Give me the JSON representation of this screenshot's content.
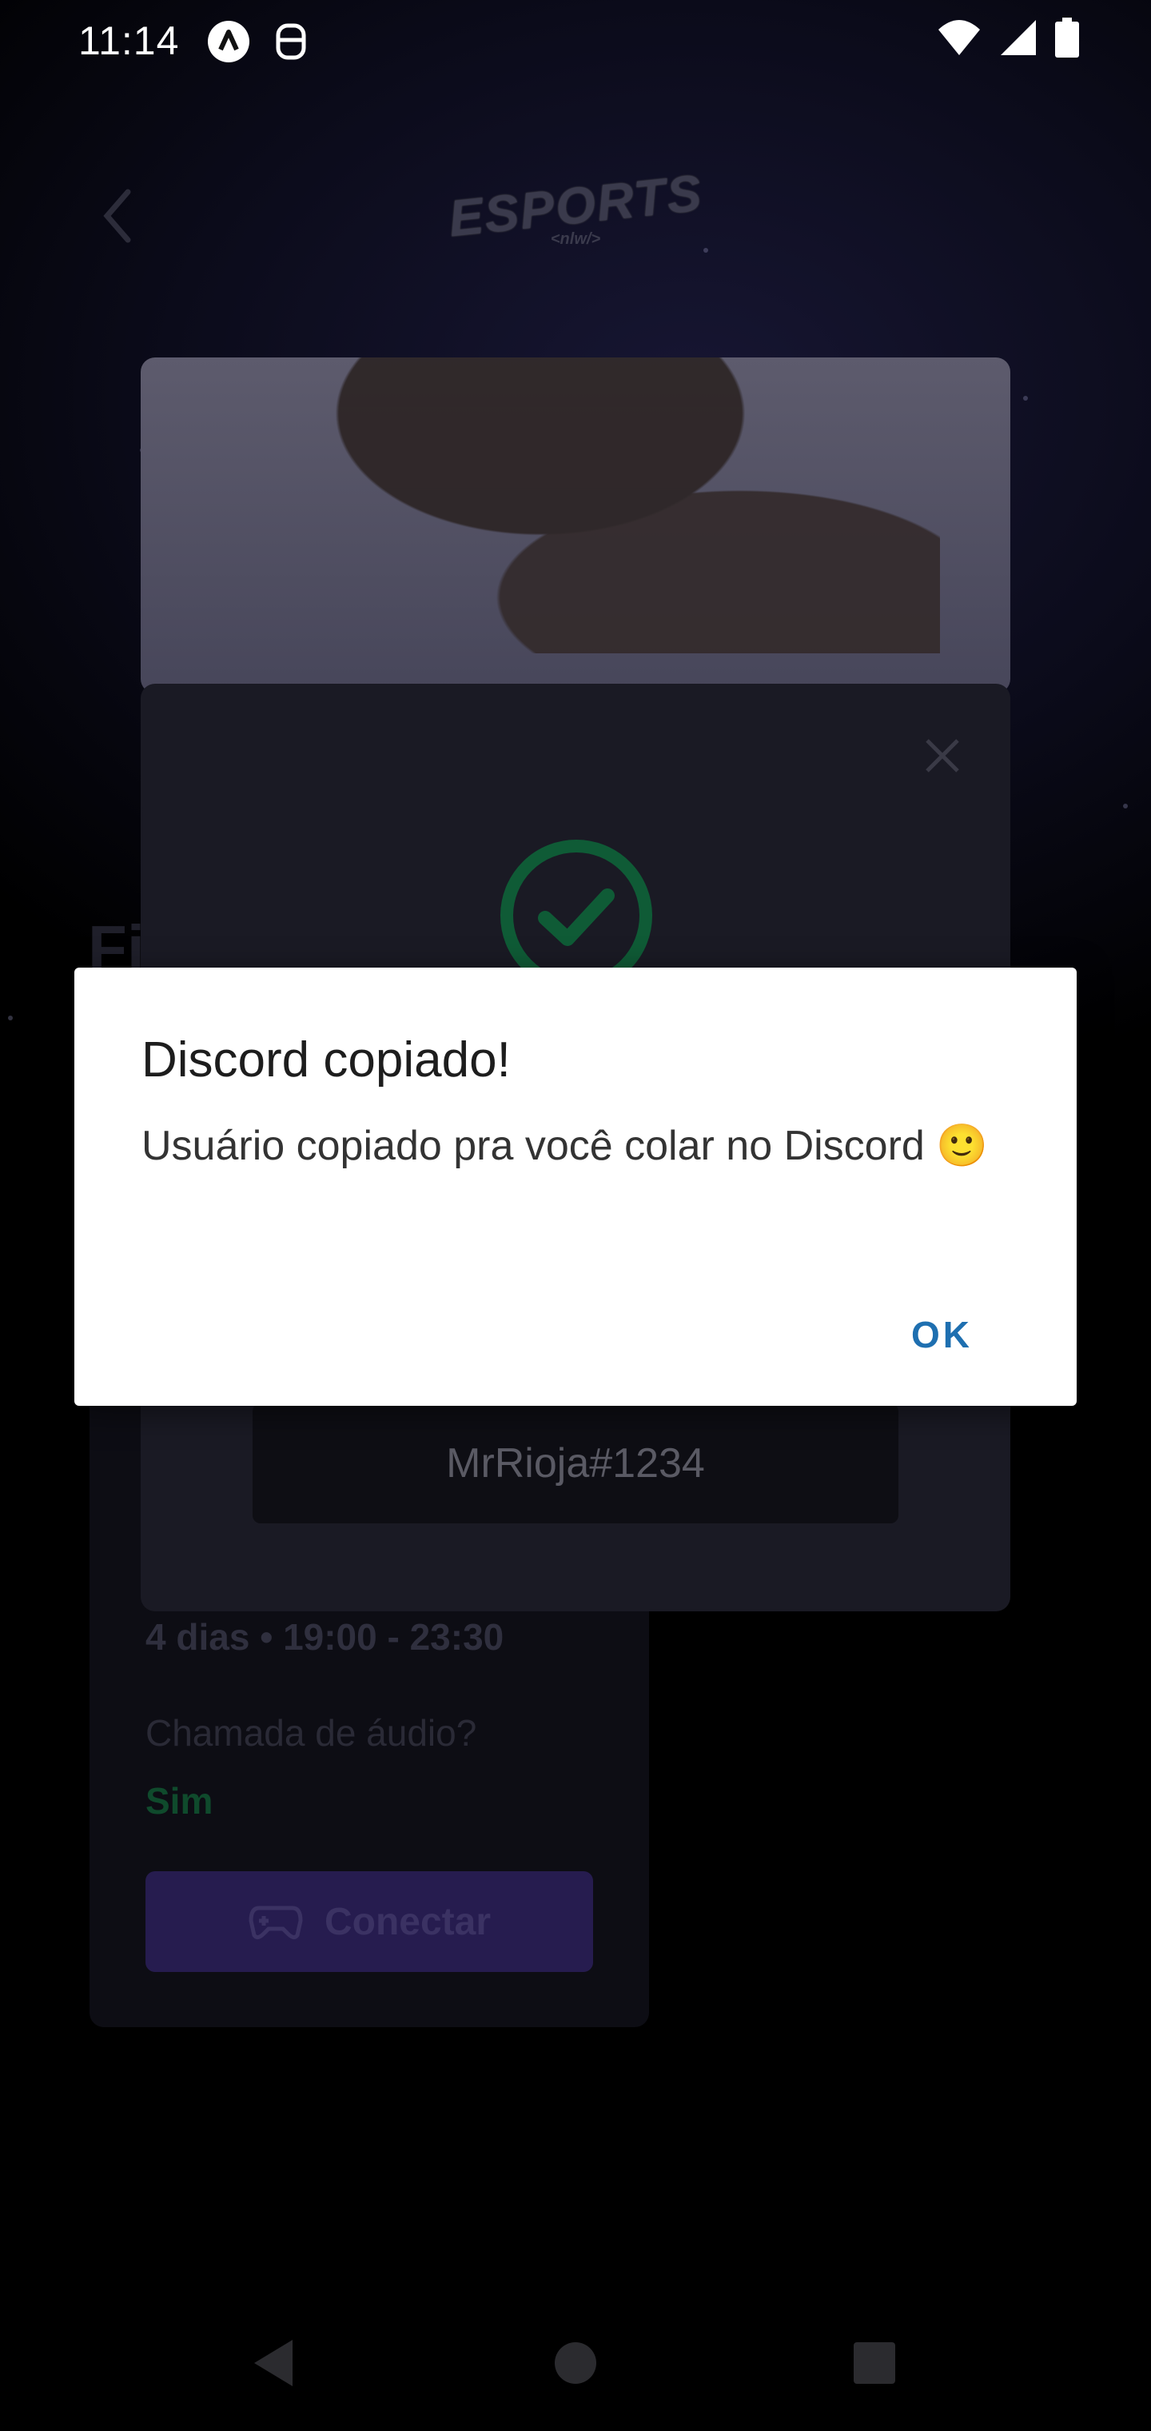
{
  "status_bar": {
    "time": "11:14",
    "icons": [
      "app-a-icon",
      "secure-icon",
      "wifi-icon",
      "signal-icon",
      "battery-icon"
    ]
  },
  "header": {
    "logo_text": "ESPORTS",
    "logo_sub": "<nlw/>"
  },
  "background_card": {
    "partial_title": "Fi",
    "schedule": "4 dias • 19:00 - 23:30",
    "audio_label": "Chamada de áudio?",
    "audio_value": "Sim",
    "connect_label": "Conectar"
  },
  "modal": {
    "discord_user": "MrRioja#1234"
  },
  "dialog": {
    "title": "Discord copiado!",
    "message": "Usuário copiado pra você colar no Discord 🙂",
    "ok_label": "OK"
  },
  "colors": {
    "dialog_ok": "#1e6fb0",
    "success_green": "#0f5b36",
    "accent_purple": "#261c4f"
  }
}
